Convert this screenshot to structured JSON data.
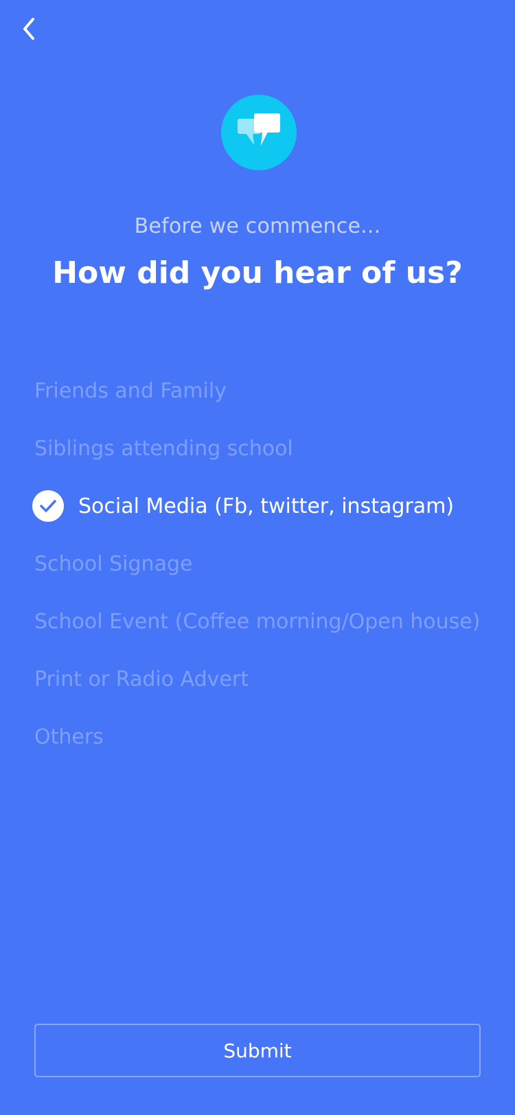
{
  "header": {
    "back_icon": "chevron-left-icon",
    "hero_icon": "chat-bubbles-icon",
    "hero_icon_color": "#0FC8F2"
  },
  "intro": {
    "subtitle": "Before we commence...",
    "title": "How did you hear of us?"
  },
  "options": [
    {
      "label": "Friends and Family",
      "selected": false
    },
    {
      "label": "Siblings attending school",
      "selected": false
    },
    {
      "label": "Social Media (Fb, twitter, instagram)",
      "selected": true
    },
    {
      "label": "School Signage",
      "selected": false
    },
    {
      "label": "School Event (Coffee morning/Open house)",
      "selected": false
    },
    {
      "label": "Print or Radio Advert",
      "selected": false
    },
    {
      "label": "Others",
      "selected": false
    }
  ],
  "footer": {
    "submit_label": "Submit"
  },
  "colors": {
    "background": "#4775F7",
    "unselected_text": "#7E9FF9",
    "selected_text": "#FFFFFF",
    "accent": "#0FC8F2"
  }
}
